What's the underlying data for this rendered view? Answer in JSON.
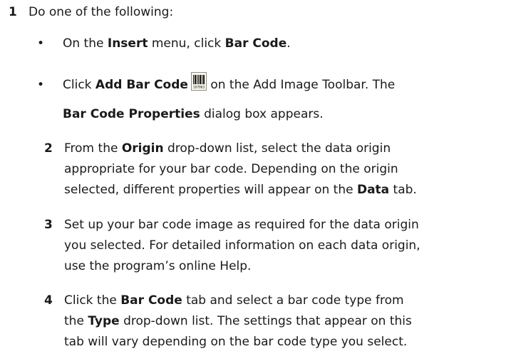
{
  "step1": {
    "number": "1",
    "text": "Do one of the following:",
    "bullets": [
      {
        "pre": "On the ",
        "bold1": "Insert",
        "mid": " menu, click ",
        "bold2": "Bar Code",
        "post": "."
      },
      {
        "pre": "Click ",
        "bold1": "Add Bar Code",
        "icon": "barcode-icon",
        "icon_caption": "107963",
        "mid": " on the Add Image Toolbar. The",
        "cont_bold": "Bar Code Properties",
        "cont_post": " dialog box appears."
      }
    ]
  },
  "steps": [
    {
      "number": "2",
      "line1_pre": "From the ",
      "line1_bold": "Origin",
      "line1_post": " drop-down list, select the data origin",
      "line2": "appropriate for your bar code. Depending on the origin",
      "line3_pre": "selected, different properties will appear on the ",
      "line3_bold": "Data",
      "line3_post": " tab."
    },
    {
      "number": "3",
      "line1": "Set up your bar code image as required for the data origin",
      "line2": "you selected. For detailed information on each data origin,",
      "line3": "use the program’s online Help."
    },
    {
      "number": "4",
      "line1_pre": "Click the ",
      "line1_bold": "Bar Code",
      "line1_post": " tab and select a bar code type from",
      "line2_pre": "the ",
      "line2_bold": "Type",
      "line2_post": " drop-down list. The settings that appear on this",
      "line3": "tab will vary depending on the bar code type you select."
    }
  ]
}
